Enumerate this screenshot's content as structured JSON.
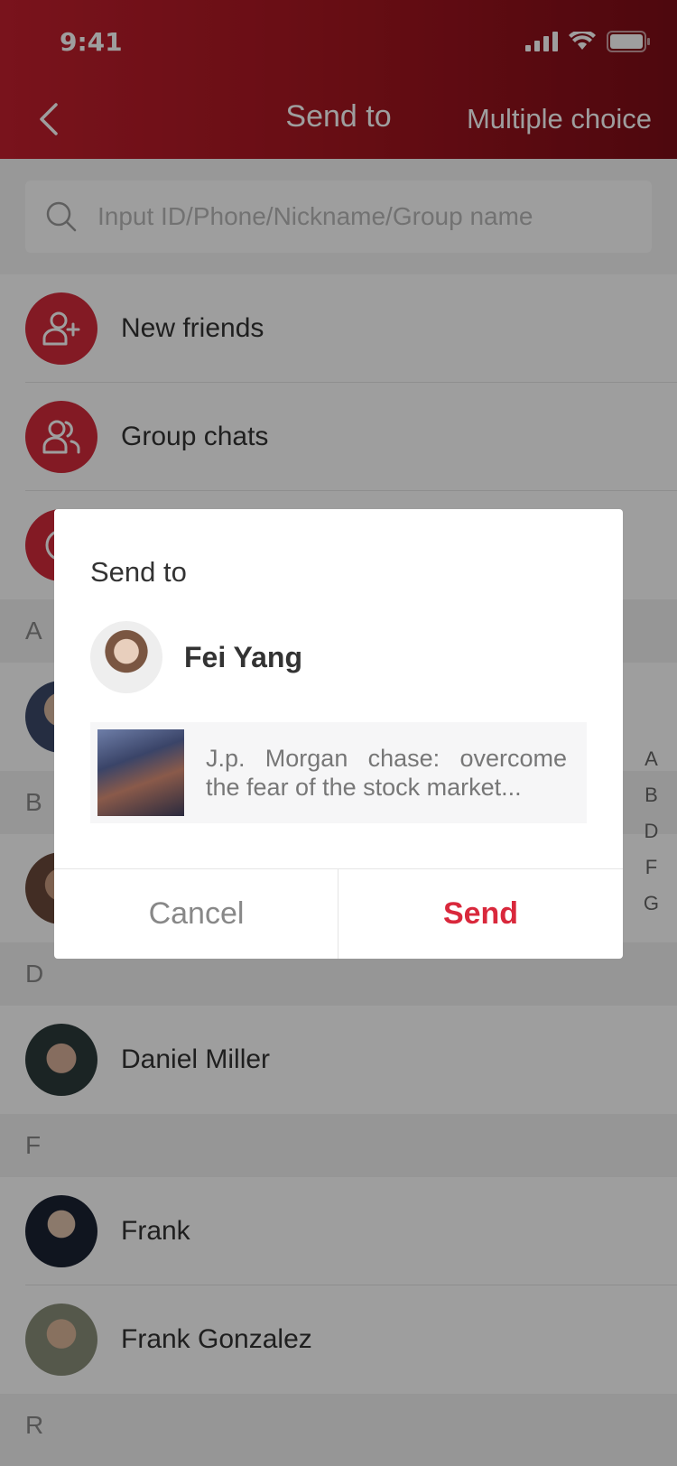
{
  "status_bar": {
    "time": "9:41"
  },
  "nav": {
    "title": "Send to",
    "right_action": "Multiple choice"
  },
  "search": {
    "placeholder": "Input ID/Phone/Nickname/Group name"
  },
  "menu_items": [
    {
      "label": "New friends",
      "icon": "add-user-icon"
    },
    {
      "label": "Group chats",
      "icon": "group-icon"
    },
    {
      "label": "",
      "icon": "official-account-icon"
    }
  ],
  "sections": [
    {
      "letter": "A",
      "contacts": [
        ""
      ]
    },
    {
      "letter": "B",
      "contacts": [
        ""
      ]
    },
    {
      "letter": "D",
      "contacts": [
        "Daniel Miller"
      ]
    },
    {
      "letter": "F",
      "contacts": [
        "Frank",
        "Frank Gonzalez"
      ]
    },
    {
      "letter": "R",
      "contacts": []
    }
  ],
  "index_letters": [
    "A",
    "B",
    "D",
    "F",
    "G"
  ],
  "dialog": {
    "title": "Send to",
    "recipient_name": "Fei Yang",
    "share_text": "J.p. Morgan chase: overcome the fear of the stock market...",
    "cancel_label": "Cancel",
    "send_label": "Send"
  },
  "colors": {
    "brand": "#c41f2e",
    "send": "#d9283c"
  }
}
